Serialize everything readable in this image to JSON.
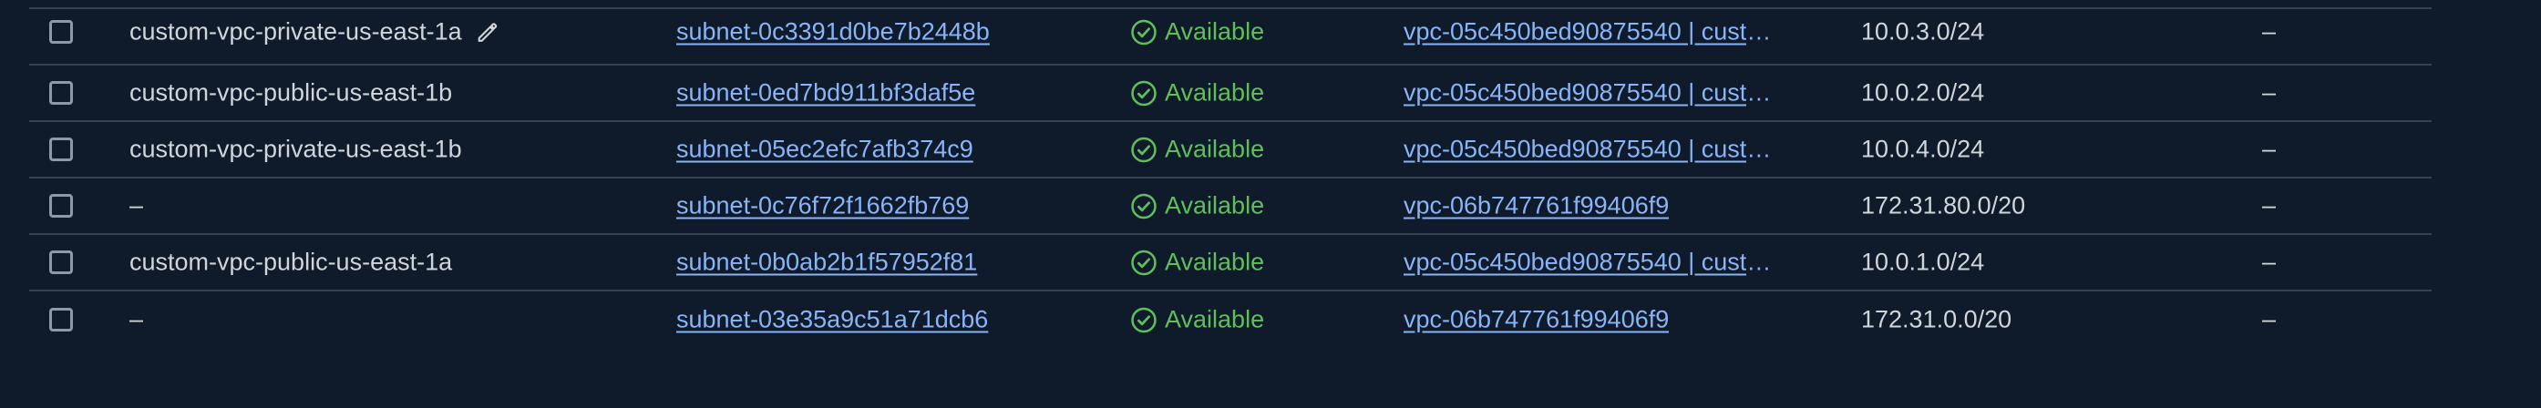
{
  "status_color": "#5fbf5a",
  "link_color": "#89b4f8",
  "rows": [
    {
      "name": "custom-vpc-private-us-east-1a",
      "subnet_id": "subnet-0c3391d0be7b2448b",
      "state": "Available",
      "vpc": "vpc-05c450bed90875540 | cust",
      "ellipsis": "…",
      "cidr": "10.0.3.0/24",
      "extra": "–",
      "editable": true
    },
    {
      "name": "custom-vpc-public-us-east-1b",
      "subnet_id": "subnet-0ed7bd911bf3daf5e",
      "state": "Available",
      "vpc": "vpc-05c450bed90875540 | cust",
      "ellipsis": "…",
      "cidr": "10.0.2.0/24",
      "extra": "–"
    },
    {
      "name": "custom-vpc-private-us-east-1b",
      "subnet_id": "subnet-05ec2efc7afb374c9",
      "state": "Available",
      "vpc": "vpc-05c450bed90875540 | cust",
      "ellipsis": "…",
      "cidr": "10.0.4.0/24",
      "extra": "–"
    },
    {
      "name": "–",
      "subnet_id": "subnet-0c76f72f1662fb769",
      "state": "Available",
      "vpc": "vpc-06b747761f99406f9",
      "ellipsis": "",
      "cidr": "172.31.80.0/20",
      "extra": "–"
    },
    {
      "name": "custom-vpc-public-us-east-1a",
      "subnet_id": "subnet-0b0ab2b1f57952f81",
      "state": "Available",
      "vpc": "vpc-05c450bed90875540 | cust",
      "ellipsis": "…",
      "cidr": "10.0.1.0/24",
      "extra": "–"
    },
    {
      "name": "–",
      "subnet_id": "subnet-03e35a9c51a71dcb6",
      "state": "Available",
      "vpc": "vpc-06b747761f99406f9",
      "ellipsis": "",
      "cidr": "172.31.0.0/20",
      "extra": "–"
    }
  ]
}
